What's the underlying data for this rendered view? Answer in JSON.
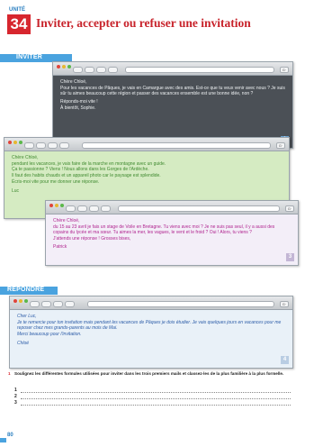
{
  "header": {
    "unit_label": "UNITÉ",
    "unit_number": "34",
    "title": "Inviter, accepter ou refuser une invitation"
  },
  "sections": {
    "inviter": "INVITER",
    "repondre": "RÉPONDRE"
  },
  "emails": [
    {
      "number": "1",
      "lines": [
        "Chère Chloé,",
        "Pour les vacances de Pâques, je vais en Camargue avec des amis. Est-ce que tu veux venir avec nous ? Je suis sûr tu aimes beaucoup cette région et passer des vacances ensemble est une bonne idée, non ?",
        "Réponds-moi vite !",
        "À bientôt, Sophie."
      ]
    },
    {
      "number": "2",
      "lines": [
        "Chère Chloé,",
        "pendant les vacances, je vais faire de la marche en montagne avec un guide.",
        "Ça te passionne ? Viens ! Nous allons dans les Gorges de l'Ardèche.",
        "Il faut des habits chauds et un appareil photo car le paysage est splendide.",
        "Écris-moi vite pour me donner une réponse.",
        "Luc"
      ]
    },
    {
      "number": "3",
      "lines": [
        "Chère Chloé,",
        "du 15 au 23 avril je fais un stage de Voile en Bretagne. Tu viens avec moi ? Je ne suis pas seul, il y a aussi des copains du lycée et ma sœur. Tu aimes la mer, les vagues, le vent et le froid ? Oui ! Alors, tu viens ?",
        "J'attends une réponse ! Grosses bises,",
        "Patrick"
      ]
    },
    {
      "number": "4",
      "lines": [
        "Cher Luc,",
        "Je te remercie pour ton invitation mais pendant les vacances de Pâques je dois étudier. Je vais quelques jours en vacances pour me reposer chez mes grands-parents au mois de Mai.",
        "Merci beaucoup pour l'invitation.",
        "Chloé"
      ]
    }
  ],
  "exercise": {
    "number": "1",
    "instruction": "Soulignez les différentes formules utilisées pour inviter dans les trois premiers mails et classez-les de la plus familière à la plus formelle.",
    "answers": [
      "1",
      "2",
      "3"
    ]
  },
  "page_number": "80",
  "colors": {
    "unit_red": "#d7262e",
    "section_blue": "#4aa3df",
    "mail1_bg": "#4b5056",
    "mail2_bg": "#d5ebc2",
    "mail3_bg": "#f3eef8",
    "mail4_bg": "#e9f1f8"
  }
}
